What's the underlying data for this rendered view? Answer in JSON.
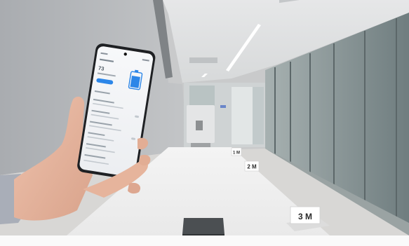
{
  "scene": {
    "colors": {
      "wall": "#b5b8bc",
      "ceiling": "#e9eaeb",
      "glass_panel": "#7f8d8e",
      "table": "#f2f2f2",
      "floor": "#d8d7d5",
      "skin": "#e4b49e",
      "sleeve": "#a9aeb8",
      "screen_accent": "#2c86e8"
    }
  },
  "phone": {
    "battery_percent": "73",
    "battery_level": 0.73
  },
  "signs": {
    "near": "3 M",
    "mid": "2 M",
    "far": "1 M"
  }
}
